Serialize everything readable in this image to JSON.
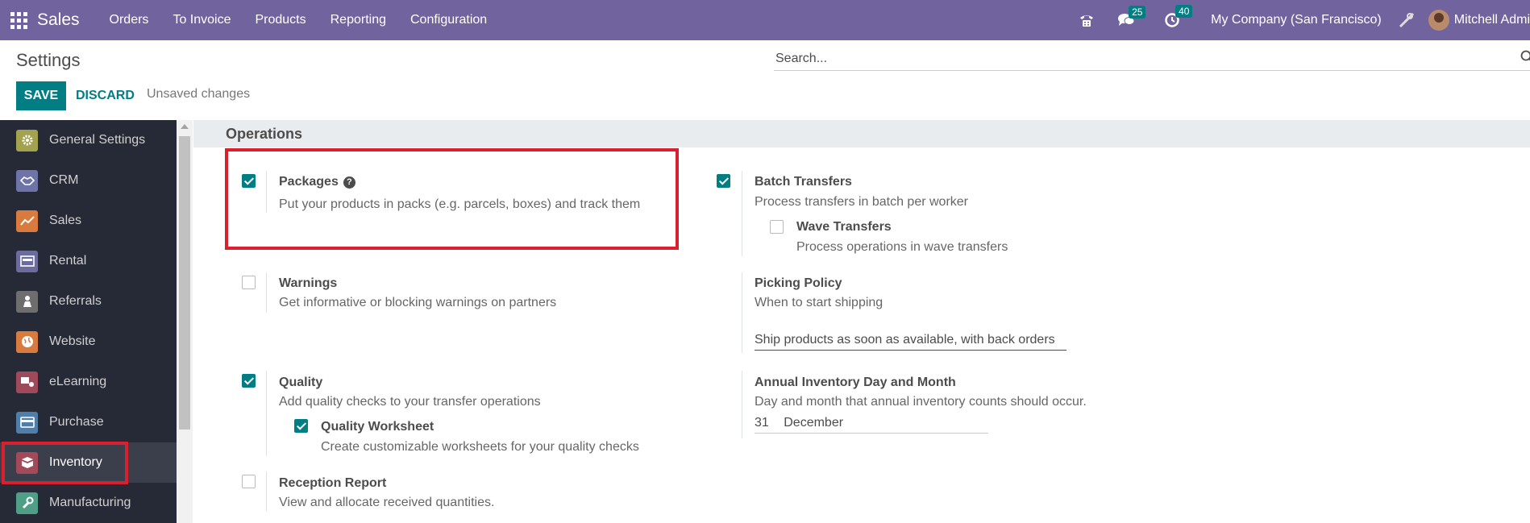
{
  "navbar": {
    "app_name": "Sales",
    "menu": [
      "Orders",
      "To Invoice",
      "Products",
      "Reporting",
      "Configuration"
    ],
    "chat_count": "25",
    "activity_count": "40",
    "company": "My Company (San Francisco)",
    "user": "Mitchell Admi"
  },
  "control_panel": {
    "title": "Settings",
    "search_placeholder": "Search...",
    "save_label": "SAVE",
    "discard_label": "DISCARD",
    "status": "Unsaved changes"
  },
  "sidebar": {
    "items": [
      {
        "label": "General Settings",
        "icon": "gear-icon",
        "color": "#a3a24f"
      },
      {
        "label": "CRM",
        "icon": "handshake-icon",
        "color": "#6f74a8"
      },
      {
        "label": "Sales",
        "icon": "chart-line-icon",
        "color": "#d97a3e"
      },
      {
        "label": "Rental",
        "icon": "rental-icon",
        "color": "#6b6b9e"
      },
      {
        "label": "Referrals",
        "icon": "referrals-icon",
        "color": "#6e6e6e"
      },
      {
        "label": "Website",
        "icon": "globe-icon",
        "color": "#d97a3e"
      },
      {
        "label": "eLearning",
        "icon": "elearning-icon",
        "color": "#9e4a5a"
      },
      {
        "label": "Purchase",
        "icon": "credit-card-icon",
        "color": "#4f7fa8"
      },
      {
        "label": "Inventory",
        "icon": "box-icon",
        "color": "#a34a5a",
        "active": true
      },
      {
        "label": "Manufacturing",
        "icon": "wrench-icon",
        "color": "#4f9e86"
      }
    ]
  },
  "section": {
    "title": "Operations"
  },
  "settings": {
    "packages": {
      "title": "Packages",
      "desc": "Put your products in packs (e.g. parcels, boxes) and track them",
      "checked": true
    },
    "batch_transfers": {
      "title": "Batch Transfers",
      "desc": "Process transfers in batch per worker",
      "checked": true
    },
    "wave_transfers": {
      "title": "Wave Transfers",
      "desc": "Process operations in wave transfers",
      "checked": false
    },
    "warnings": {
      "title": "Warnings",
      "desc": "Get informative or blocking warnings on partners",
      "checked": false
    },
    "picking_policy": {
      "title": "Picking Policy",
      "desc": "When to start shipping",
      "value": "Ship products as soon as available, with back orders"
    },
    "quality": {
      "title": "Quality",
      "desc": "Add quality checks to your transfer operations",
      "checked": true
    },
    "quality_worksheet": {
      "title": "Quality Worksheet",
      "desc": "Create customizable worksheets for your quality checks",
      "checked": true
    },
    "annual_inventory": {
      "title": "Annual Inventory Day and Month",
      "desc": "Day and month that annual inventory counts should occur.",
      "day": "31",
      "month": "December"
    },
    "reception_report": {
      "title": "Reception Report",
      "desc": "View and allocate received quantities.",
      "checked": false
    }
  },
  "colors": {
    "navbar": "#71639e",
    "primary": "#017e84",
    "highlight": "#d9202f",
    "sidebar": "#262a36"
  }
}
